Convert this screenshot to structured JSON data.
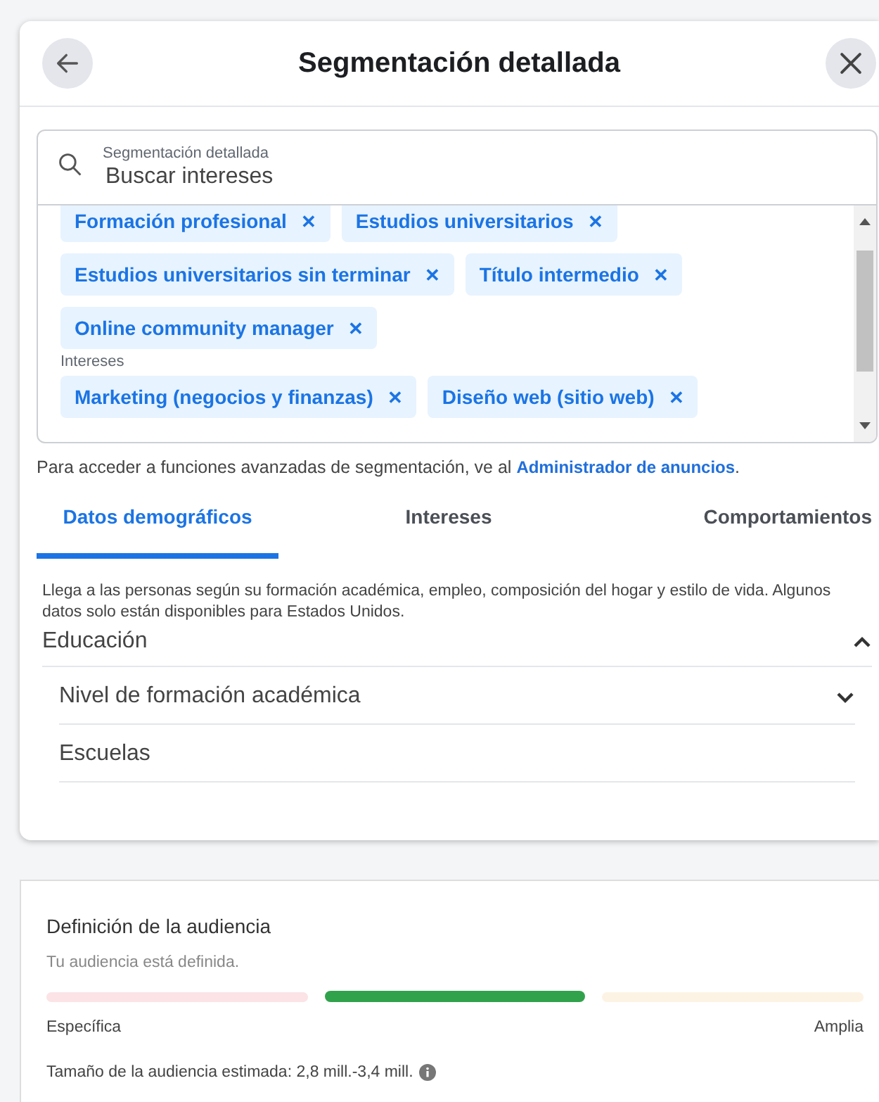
{
  "dialog": {
    "title": "Segmentación detallada",
    "search": {
      "label": "Segmentación detallada",
      "placeholder": "Buscar intereses"
    },
    "tag_groups": [
      {
        "tags": [
          "Formación profesional",
          "Estudios universitarios",
          "Estudios universitarios sin terminar",
          "Título intermedio",
          "Online community manager"
        ]
      },
      {
        "label": "Intereses",
        "tags": [
          "Marketing (negocios y finanzas)",
          "Diseño web (sitio web)"
        ]
      }
    ],
    "remove_glyph": "✕",
    "notice": "Para acceder a funciones avanzadas de segmentación, ve al ",
    "notice_link": "Administrador de anuncios",
    "notice_end": ".",
    "tabs": [
      {
        "label": "Datos demográficos",
        "selected": true
      },
      {
        "label": "Intereses",
        "selected": false
      },
      {
        "label": "Comportamientos",
        "selected": false
      }
    ],
    "description": "Llega a las personas según su formación académica, empleo, composición del hogar y estilo de vida. Algunos datos solo están disponibles para Estados Unidos.",
    "category": {
      "label": "Educación",
      "expanded": true,
      "children": [
        {
          "label": "Nivel de formación académica",
          "kind": "expandable",
          "expanded": false
        },
        {
          "label": "Escuelas",
          "kind": "plain"
        }
      ]
    }
  },
  "audience": {
    "title": "Definición de la audiencia",
    "status": "Tu audiencia está definida.",
    "segments": [
      {
        "color": "#fbe3e6",
        "selected": false
      },
      {
        "color": "#31a24c",
        "selected": true
      },
      {
        "color": "#fdf3e4",
        "selected": false
      }
    ],
    "low_label": "Específica",
    "high_label": "Amplia",
    "estimate": "Tamaño de la audiencia estimada: 2,8 mill.-3,4 mill."
  }
}
